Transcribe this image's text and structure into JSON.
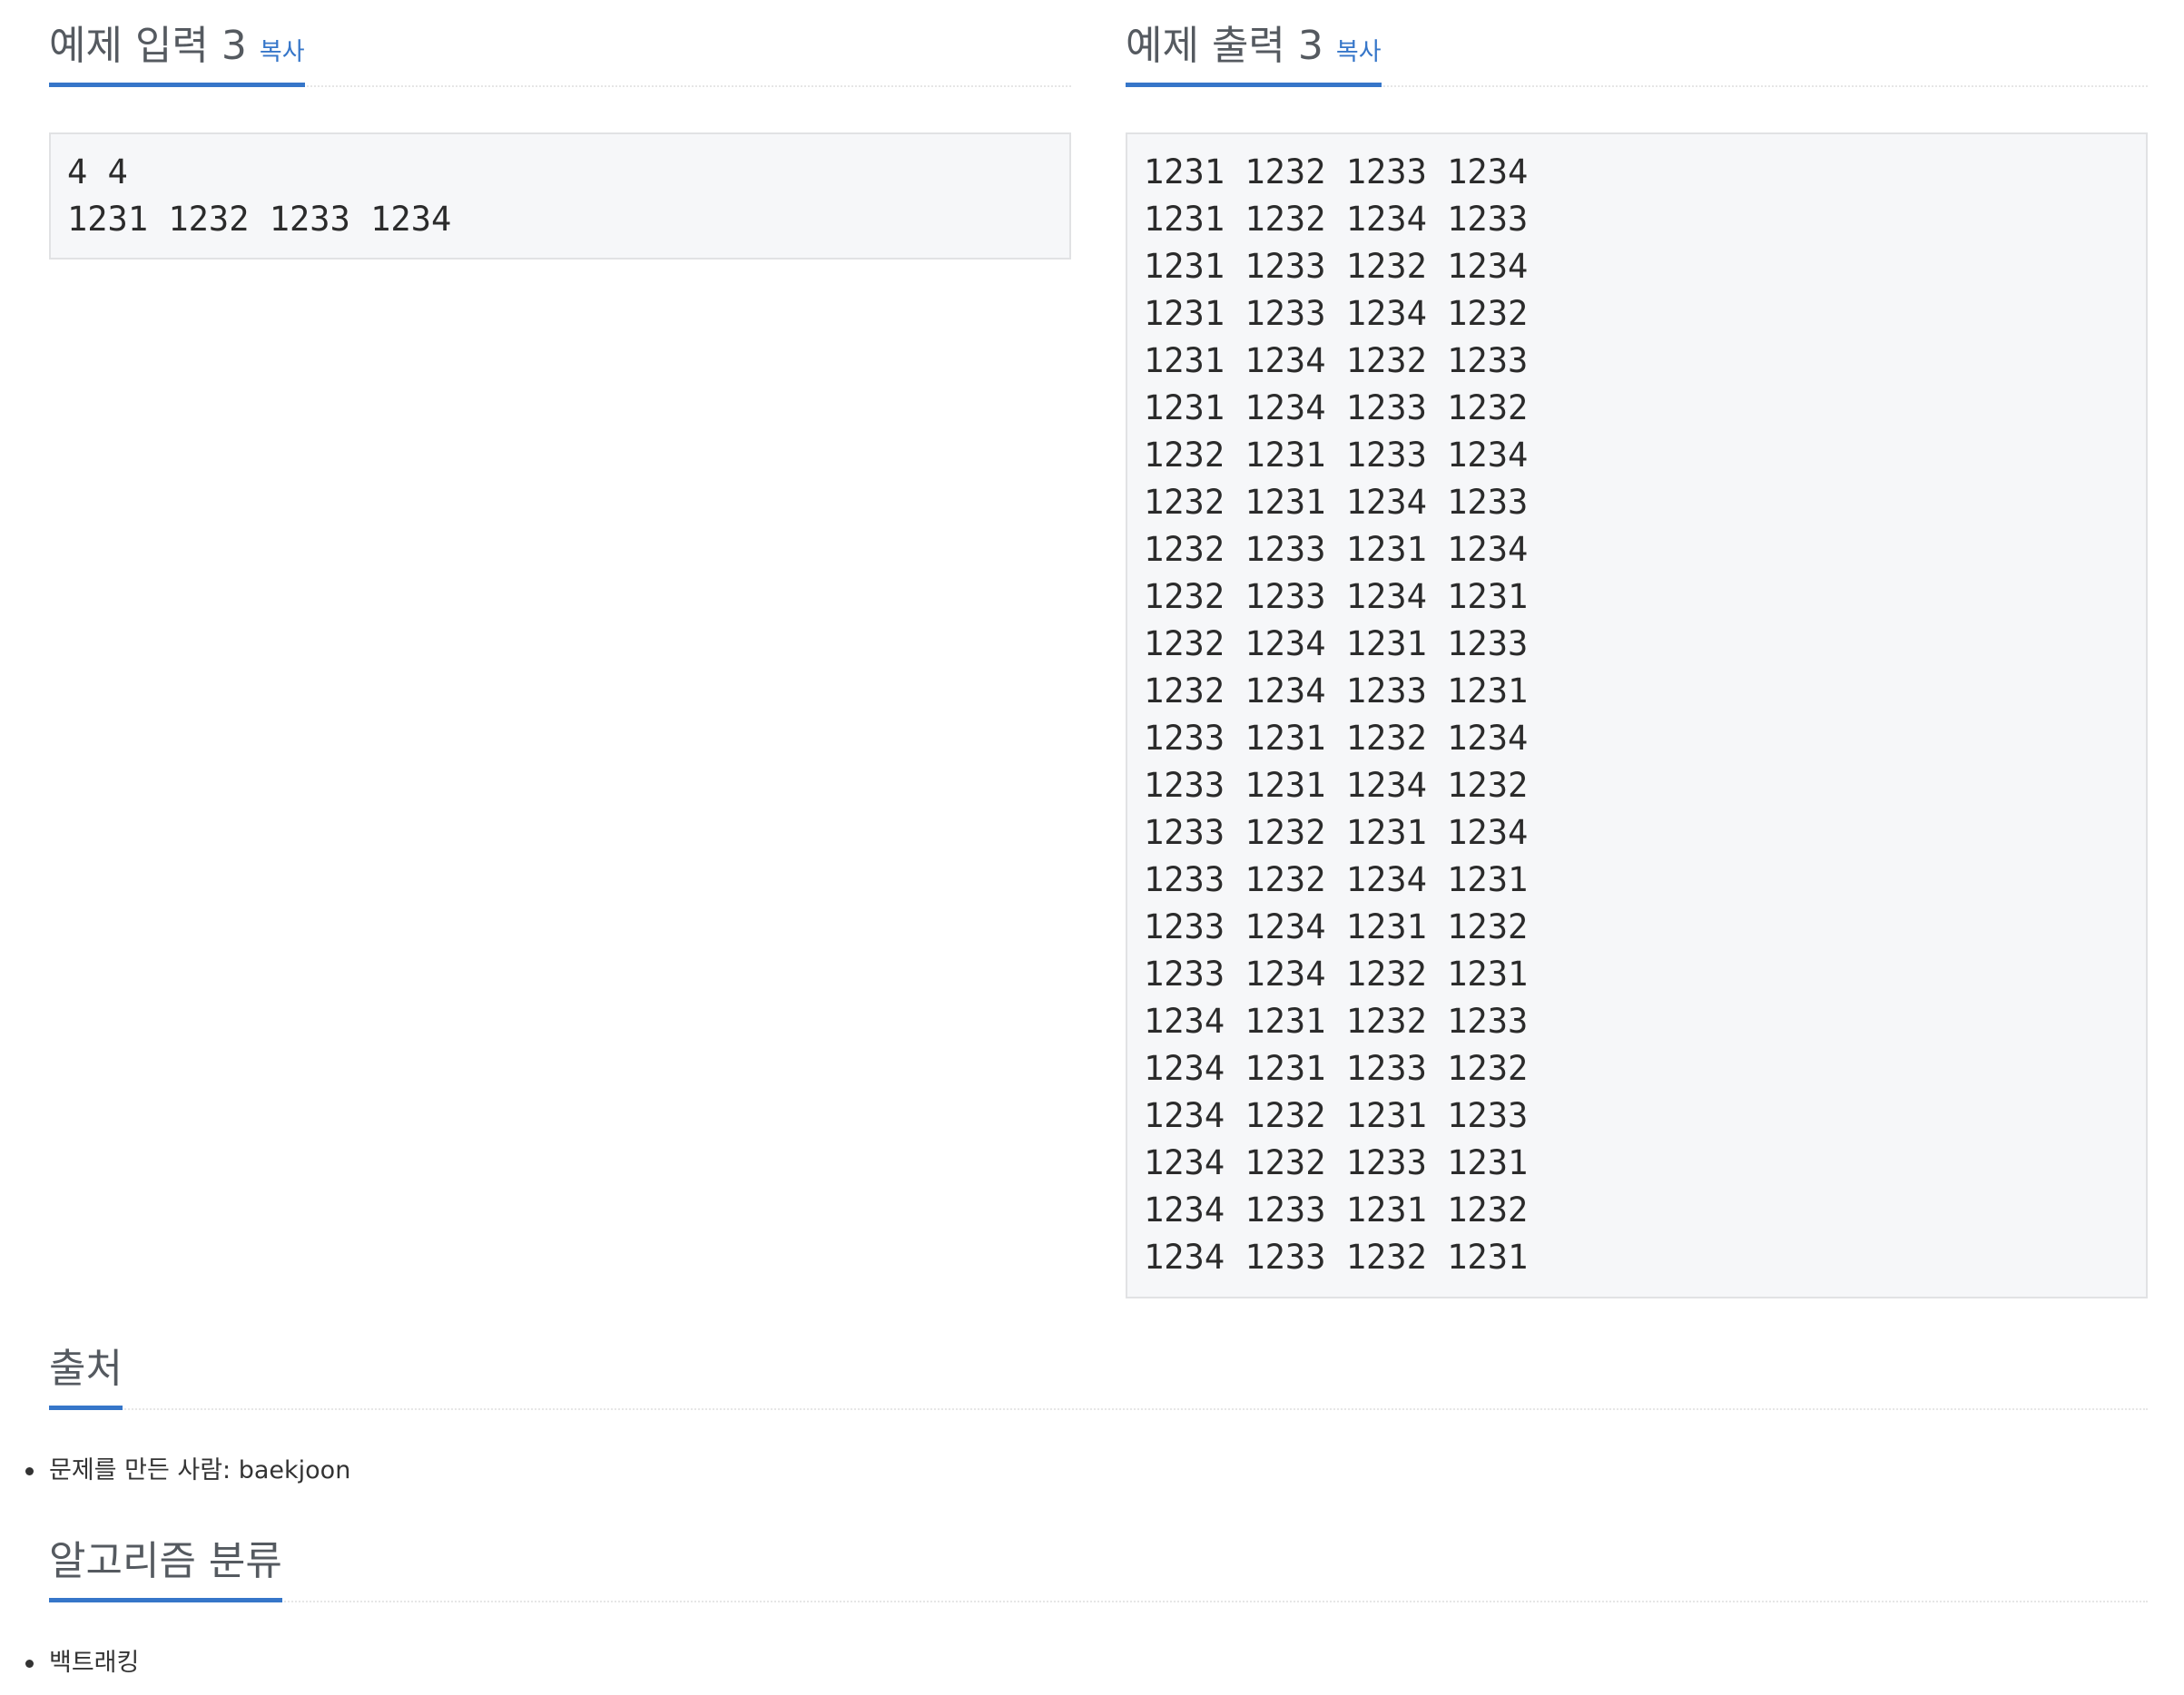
{
  "sample_input": {
    "title": "예제 입력 3",
    "copy_label": "복사",
    "lines": [
      "4 4",
      "1231 1232 1233 1234"
    ]
  },
  "sample_output": {
    "title": "예제 출력 3",
    "copy_label": "복사",
    "lines": [
      "1231 1232 1233 1234",
      "1231 1232 1234 1233",
      "1231 1233 1232 1234",
      "1231 1233 1234 1232",
      "1231 1234 1232 1233",
      "1231 1234 1233 1232",
      "1232 1231 1233 1234",
      "1232 1231 1234 1233",
      "1232 1233 1231 1234",
      "1232 1233 1234 1231",
      "1232 1234 1231 1233",
      "1232 1234 1233 1231",
      "1233 1231 1232 1234",
      "1233 1231 1234 1232",
      "1233 1232 1231 1234",
      "1233 1232 1234 1231",
      "1233 1234 1231 1232",
      "1233 1234 1232 1231",
      "1234 1231 1232 1233",
      "1234 1231 1233 1232",
      "1234 1232 1231 1233",
      "1234 1232 1233 1231",
      "1234 1233 1231 1232",
      "1234 1233 1232 1231"
    ]
  },
  "source": {
    "title": "출처",
    "items": [
      "문제를 만든 사람: baekjoon"
    ]
  },
  "algorithm": {
    "title": "알고리즘 분류",
    "items": [
      "백트래킹"
    ]
  },
  "colors": {
    "accent": "#3676c9",
    "heading": "#555a60",
    "box_background": "#f6f7f9"
  }
}
